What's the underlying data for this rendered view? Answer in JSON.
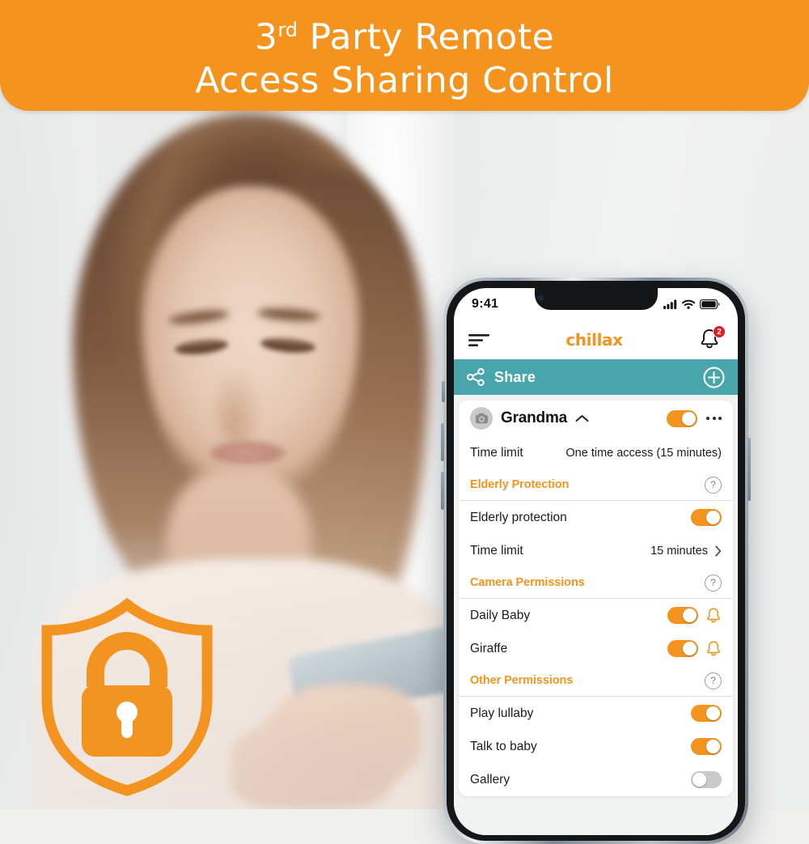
{
  "banner": {
    "line1_prefix": "3",
    "line1_ordinal": "rd",
    "line1_rest": " Party Remote",
    "line2": "Access Sharing Control",
    "background_color": "#F4941F",
    "text_color": "#FFFFFF"
  },
  "badge": {
    "icon": "shield-lock-icon",
    "color": "#F2941F"
  },
  "phone": {
    "status_bar": {
      "time": "9:41",
      "icons": [
        "cellular-signal-icon",
        "wifi-icon",
        "battery-icon"
      ]
    },
    "app_header": {
      "menu_icon": "hamburger-menu-icon",
      "logo": "chillax",
      "logo_color": "#F4941F",
      "bell_icon": "notification-bell-icon",
      "bell_badge": "2",
      "bell_badge_color": "#E11B22"
    },
    "share_bar": {
      "icon": "share-nodes-icon",
      "label": "Share",
      "add_icon": "plus-circle-icon",
      "background_color": "#48A5AC"
    },
    "card": {
      "header": {
        "avatar_icon": "camera-avatar-icon",
        "name": "Grandma",
        "chevron": "chevron-up-icon",
        "toggle": "on",
        "overflow_icon": "more-options-icon"
      },
      "time_limit_row": {
        "label": "Time limit",
        "value": "One time access (15 minutes)"
      },
      "sections": [
        {
          "title": "Elderly Protection",
          "help_icon": "help-circle-icon",
          "rows": [
            {
              "label": "Elderly protection",
              "control": "toggle",
              "state": "on"
            },
            {
              "label": "Time limit",
              "control": "value-chevron",
              "value": "15 minutes"
            }
          ]
        },
        {
          "title": "Camera Permissions",
          "help_icon": "help-circle-icon",
          "rows": [
            {
              "label": "Daily Baby",
              "control": "toggle-bell",
              "state": "on",
              "bell_icon": "bell-icon"
            },
            {
              "label": "Giraffe",
              "control": "toggle-bell",
              "state": "on",
              "bell_icon": "bell-icon"
            }
          ]
        },
        {
          "title": "Other Permissions",
          "help_icon": "help-circle-icon",
          "rows": [
            {
              "label": "Play lullaby",
              "control": "toggle",
              "state": "on"
            },
            {
              "label": "Talk to baby",
              "control": "toggle",
              "state": "on"
            },
            {
              "label": "Gallery",
              "control": "toggle",
              "state": "off"
            }
          ]
        }
      ]
    }
  }
}
